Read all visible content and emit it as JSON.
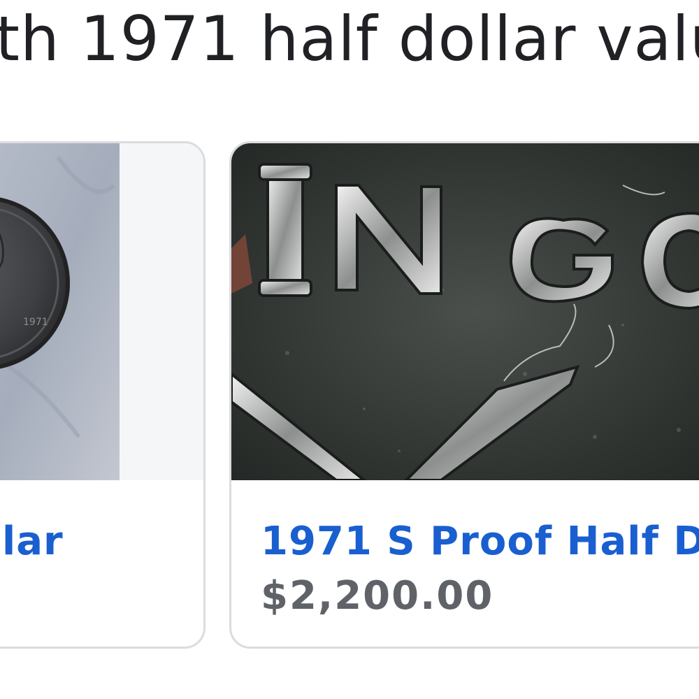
{
  "heading": "ith 1971 half dollar valu",
  "cards": [
    {
      "title": "lar",
      "image_icon": "coin-photo-icon"
    },
    {
      "title": "1971 S Proof Half D...",
      "price": "$2,200.00",
      "image_icon": "coin-closeup-photo-icon"
    }
  ],
  "colors": {
    "title_link": "#1a5fd0",
    "price": "#5f6368",
    "heading": "#202124",
    "card_border": "#dadce0"
  }
}
